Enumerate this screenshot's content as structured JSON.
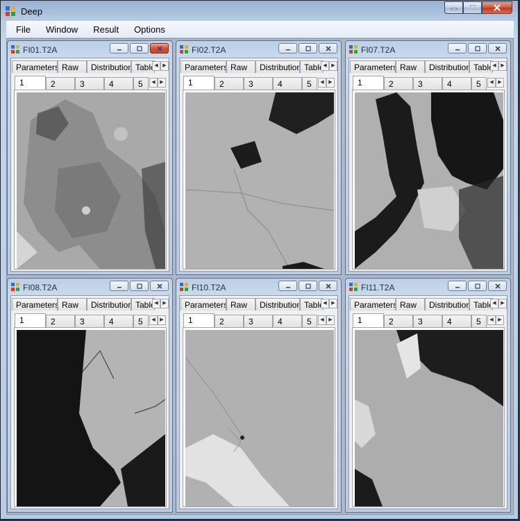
{
  "app": {
    "title": "Deep"
  },
  "menu": [
    "File",
    "Window",
    "Result",
    "Options"
  ],
  "children": [
    {
      "title": "FI01.T2A",
      "active": true
    },
    {
      "title": "FI02.T2A",
      "active": false
    },
    {
      "title": "FI07.T2A",
      "active": false
    },
    {
      "title": "FI08.T2A",
      "active": false
    },
    {
      "title": "FI10.T2A",
      "active": false
    },
    {
      "title": "FI11.T2A",
      "active": false
    }
  ],
  "tabs": [
    "Parameters",
    "Raw",
    "Distribution",
    "Table"
  ],
  "page_tabs": [
    "1",
    "2",
    "3",
    "4",
    "5"
  ],
  "selected_page_tab": "1"
}
